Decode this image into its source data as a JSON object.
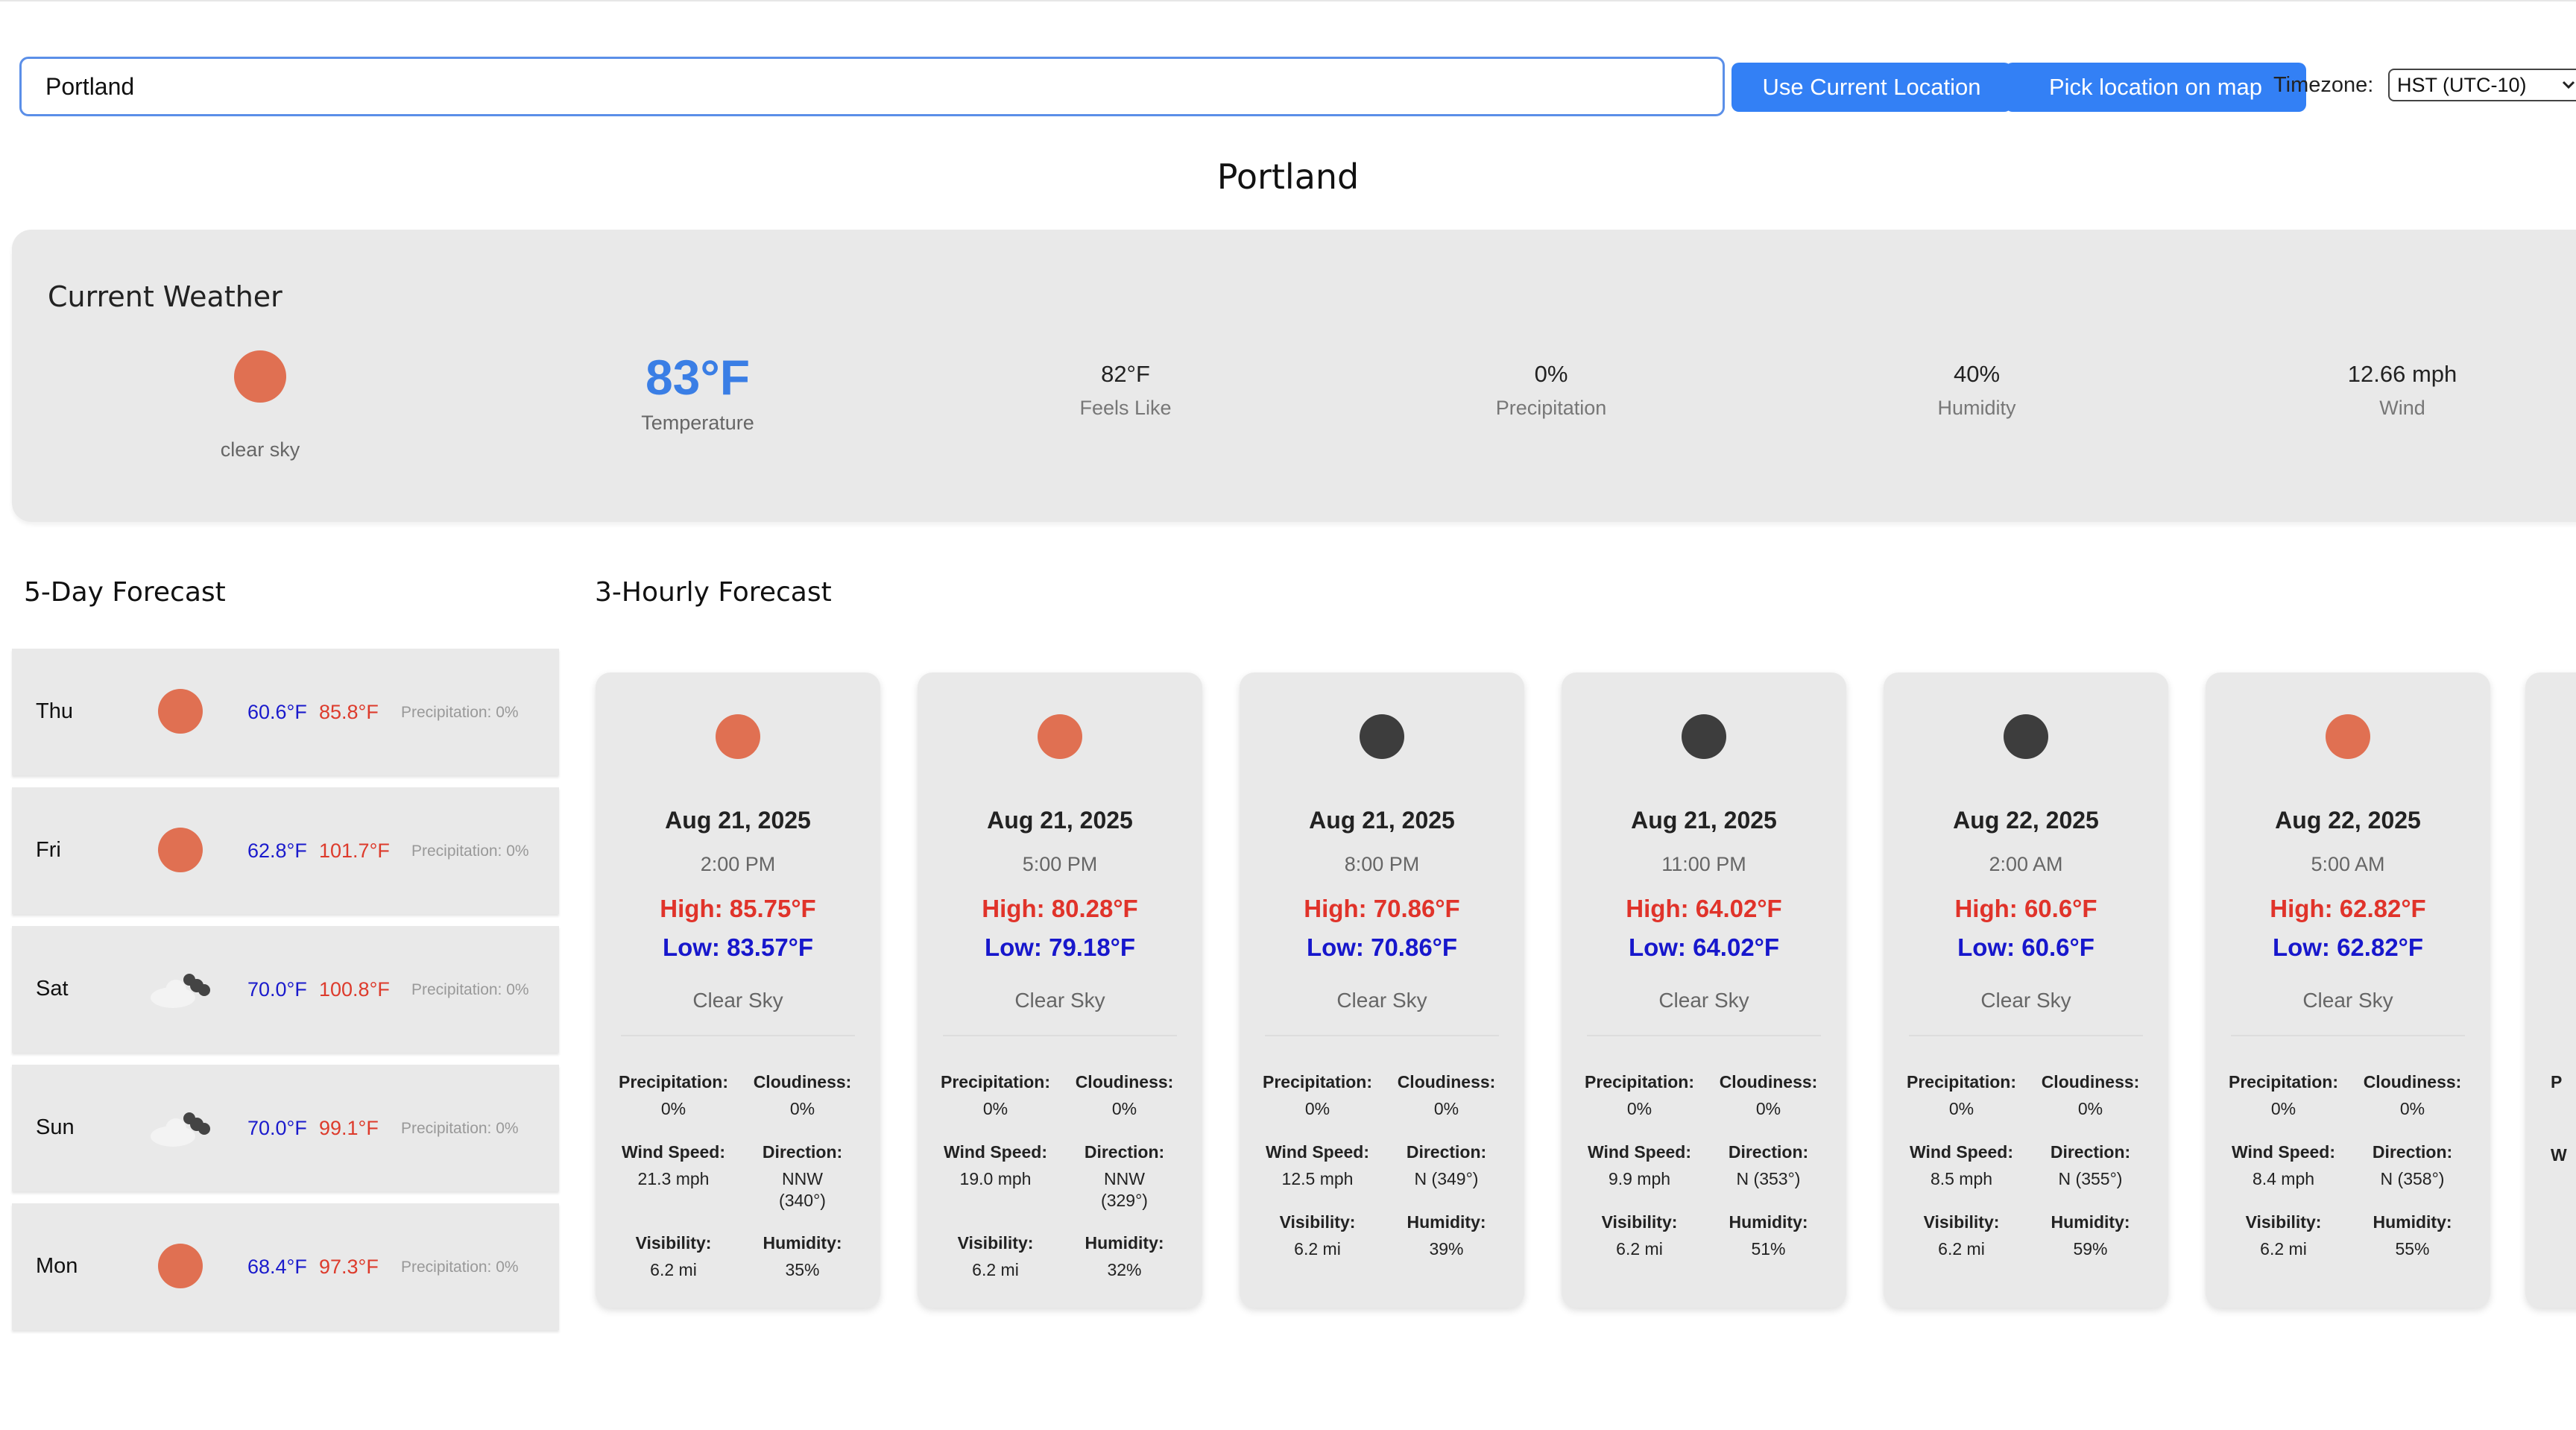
{
  "search": {
    "value": "Portland",
    "use_location_label": "Use Current Location",
    "pick_map_label": "Pick location on map",
    "timezone_label": "Timezone:",
    "timezone_value": "HST (UTC-10)"
  },
  "city": "Portland",
  "current": {
    "title": "Current Weather",
    "icon": "sun-icon",
    "description": "clear sky",
    "temperature": "83°F",
    "temperature_label": "Temperature",
    "metrics": [
      {
        "value": "82°F",
        "label": "Feels Like"
      },
      {
        "value": "0%",
        "label": "Precipitation"
      },
      {
        "value": "40%",
        "label": "Humidity"
      },
      {
        "value": "12.66 mph",
        "label": "Wind"
      }
    ]
  },
  "five_day": {
    "title": "5-Day Forecast",
    "days": [
      {
        "day": "Thu",
        "icon": "sun-icon",
        "low": "60.6°F",
        "high": "85.8°F",
        "precip": "Precipitation: 0%"
      },
      {
        "day": "Fri",
        "icon": "sun-icon",
        "low": "62.8°F",
        "high": "101.7°F",
        "precip": "Precipitation: 0%"
      },
      {
        "day": "Sat",
        "icon": "cloud-icon",
        "low": "70.0°F",
        "high": "100.8°F",
        "precip": "Precipitation: 0%"
      },
      {
        "day": "Sun",
        "icon": "cloud-icon",
        "low": "70.0°F",
        "high": "99.1°F",
        "precip": "Precipitation: 0%"
      },
      {
        "day": "Mon",
        "icon": "sun-icon",
        "low": "68.4°F",
        "high": "97.3°F",
        "precip": "Precipitation: 0%"
      }
    ]
  },
  "hourly": {
    "title": "3-Hourly Forecast",
    "labels": {
      "precipitation": "Precipitation:",
      "cloudiness": "Cloudiness:",
      "wind_speed": "Wind Speed:",
      "direction": "Direction:",
      "visibility": "Visibility:",
      "humidity": "Humidity:"
    },
    "cards": [
      {
        "icon": "sun-icon",
        "date": "Aug 21, 2025",
        "time": "2:00 PM",
        "high": "High: 85.75°F",
        "low": "Low: 83.57°F",
        "desc": "Clear Sky",
        "precip": "0%",
        "cloud": "0%",
        "wind": "21.3 mph",
        "dir": "NNW (340°)",
        "vis": "6.2 mi",
        "hum": "35%"
      },
      {
        "icon": "sun-icon",
        "date": "Aug 21, 2025",
        "time": "5:00 PM",
        "high": "High: 80.28°F",
        "low": "Low: 79.18°F",
        "desc": "Clear Sky",
        "precip": "0%",
        "cloud": "0%",
        "wind": "19.0 mph",
        "dir": "NNW (329°)",
        "vis": "6.2 mi",
        "hum": "32%"
      },
      {
        "icon": "moon-icon",
        "date": "Aug 21, 2025",
        "time": "8:00 PM",
        "high": "High: 70.86°F",
        "low": "Low: 70.86°F",
        "desc": "Clear Sky",
        "precip": "0%",
        "cloud": "0%",
        "wind": "12.5 mph",
        "dir": "N (349°)",
        "vis": "6.2 mi",
        "hum": "39%"
      },
      {
        "icon": "moon-icon",
        "date": "Aug 21, 2025",
        "time": "11:00 PM",
        "high": "High: 64.02°F",
        "low": "Low: 64.02°F",
        "desc": "Clear Sky",
        "precip": "0%",
        "cloud": "0%",
        "wind": "9.9 mph",
        "dir": "N (353°)",
        "vis": "6.2 mi",
        "hum": "51%"
      },
      {
        "icon": "moon-icon",
        "date": "Aug 22, 2025",
        "time": "2:00 AM",
        "high": "High: 60.6°F",
        "low": "Low: 60.6°F",
        "desc": "Clear Sky",
        "precip": "0%",
        "cloud": "0%",
        "wind": "8.5 mph",
        "dir": "N (355°)",
        "vis": "6.2 mi",
        "hum": "59%"
      },
      {
        "icon": "sun-icon",
        "date": "Aug 22, 2025",
        "time": "5:00 AM",
        "high": "High: 62.82°F",
        "low": "Low: 62.82°F",
        "desc": "Clear Sky",
        "precip": "0%",
        "cloud": "0%",
        "wind": "8.4 mph",
        "dir": "N (358°)",
        "vis": "6.2 mi",
        "hum": "55%"
      }
    ],
    "peek": {
      "k1": "P",
      "k2": "W"
    }
  },
  "colors": {
    "accent": "#3380f5",
    "sun": "#e07052",
    "moon": "#3d3d3d",
    "high": "#e0332a",
    "low": "#1717cc"
  }
}
